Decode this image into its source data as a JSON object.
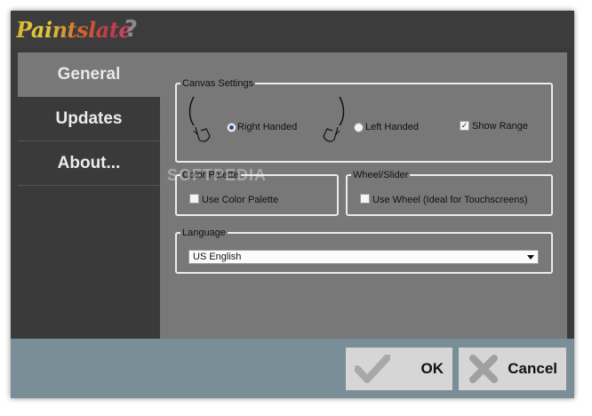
{
  "app": {
    "logo": "Paintslate",
    "help_glyph": "?"
  },
  "tabs": [
    {
      "label": "General",
      "active": true
    },
    {
      "label": "Updates",
      "active": false
    },
    {
      "label": "About...",
      "active": false
    }
  ],
  "canvas_settings": {
    "legend": "Canvas Settings",
    "right_handed_label": "Right Handed",
    "right_handed_selected": true,
    "left_handed_label": "Left Handed",
    "left_handed_selected": false,
    "show_range_label": "Show Range",
    "show_range_checked": true
  },
  "color_palette": {
    "legend": "Color Palette",
    "use_color_palette_label": "Use Color Palette",
    "checked": false
  },
  "wheel_slider": {
    "legend": "Wheel/Slider",
    "use_wheel_label": "Use Wheel (Ideal for Touchscreens)",
    "checked": false
  },
  "language": {
    "legend": "Language",
    "selected": "US English"
  },
  "footer": {
    "ok_label": "OK",
    "cancel_label": "Cancel"
  },
  "watermark": "SOFTPEDIA",
  "colors": {
    "window_bg": "#3a3a3a",
    "panel_bg": "#787878",
    "footer_bg": "#7a8e97",
    "button_bg": "#d6d6d6"
  }
}
